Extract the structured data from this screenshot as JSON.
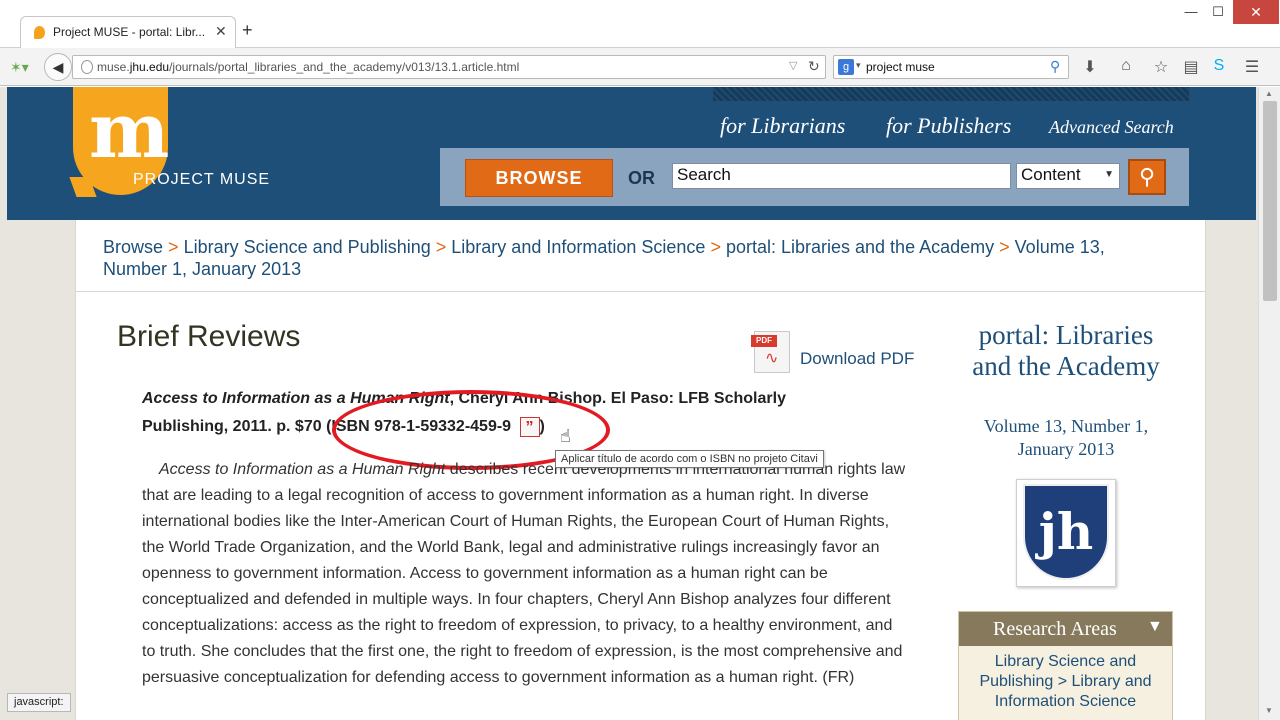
{
  "browser": {
    "tab_title": "Project MUSE - portal: Libr...",
    "tab_close": "✕",
    "new_tab": "+",
    "window_min": "—",
    "window_max": "☐",
    "window_close": "✕",
    "url_domain_prefix": "muse.",
    "url_domain": "jhu.edu",
    "url_path": "/journals/portal_libraries_and_the_academy/v013/13.1.article.html",
    "search_engine_label": "g",
    "search_value": "project muse",
    "status_text": "javascript:"
  },
  "header": {
    "logo_text": "PROJECT MUSE",
    "logo_letter": "m",
    "nav": {
      "librarians": "for Librarians",
      "publishers": "for Publishers",
      "advanced_search": "Advanced Search"
    },
    "browse_label": "BROWSE",
    "or_label": "OR",
    "search_value": "Search",
    "content_select": "Content"
  },
  "breadcrumb": {
    "items": [
      "Browse",
      "Library Science and Publishing",
      "Library and Information Science",
      "portal: Libraries and the Academy",
      "Volume 13, Number 1, January 2013"
    ],
    "separator": ">"
  },
  "article": {
    "title": "Brief Reviews",
    "download_pdf": "Download PDF",
    "pdf_tag": "PDF",
    "citation_title": "Access to Information as a Human Right",
    "citation_rest": ", Cheryl Ann Bishop. El Paso: LFB Scholarly Publishing, 2011. p. $70 (ISBN 978-1-59332-459-9",
    "citation_close": ")",
    "citavi_glyph": "”",
    "tooltip": "Aplicar título de acordo com o ISBN no projeto Citavi",
    "body_italic": "Access to Information as a Human Right",
    "body_text": " describes recent developments in international human rights law that are leading to a legal recognition of access to government information as a human right. In diverse international bodies like the Inter-American Court of Human Rights, the European Court of Human Rights, the World Trade Organization, and the World Bank, legal and administrative rulings increasingly favor an openness to government information. Access to government information as a human right can be conceptualized and defended in multiple ways. In four chapters, Cheryl Ann Bishop analyzes four different conceptualizations: access as the right to freedom of expression, to privacy, to a healthy environment, and to truth. She concludes that the first one, the right to freedom of expression, is the most comprehensive and persuasive conceptualization for defending access to government information as a human right. (FR)"
  },
  "sidebar": {
    "journal_title": "portal: Libraries and the Academy",
    "issue": "Volume 13, Number 1, January 2013",
    "publisher_logo_text": "jh",
    "research_title": "Research Areas",
    "research_toggle": "▼",
    "research_link": "Library Science and Publishing > Library and Information Science"
  },
  "colors": {
    "header_blue": "#1e4f79",
    "accent_orange": "#e06a16",
    "link_blue": "#1e4f79",
    "annotation_red": "#e21b23"
  }
}
